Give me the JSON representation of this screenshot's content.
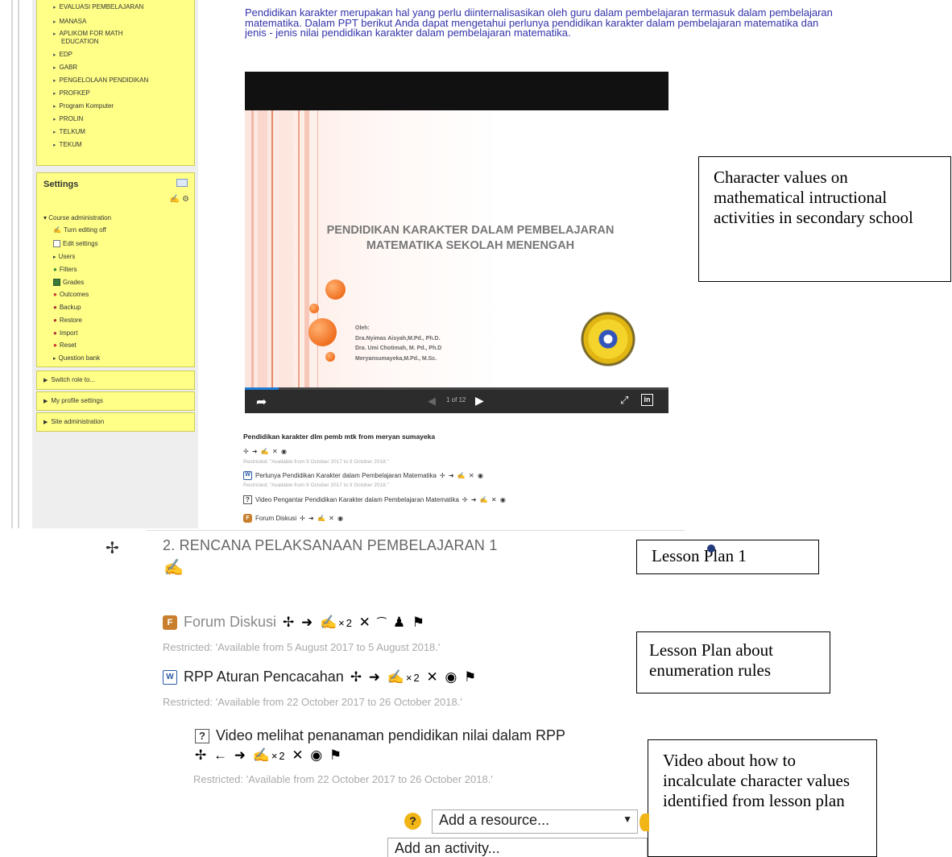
{
  "sidebar": {
    "courses": [
      "EVALUASI PEMBELAJARAN",
      "MANASA",
      "APLIKOM FOR MATH",
      "EDUCATION",
      "EDP",
      "GABR",
      "PENGELOLAAN PENDIDIKAN",
      "PROFKEP",
      "Program Komputer",
      "PROLIN",
      "TELKUM",
      "TEKUM"
    ],
    "settings_title": "Settings",
    "course_admin": "Course administration",
    "admin_items": [
      "Turn editing off",
      "Edit settings",
      "Users",
      "Filters",
      "Grades",
      "Outcomes",
      "Backup",
      "Restore",
      "Import",
      "Reset",
      "Question bank"
    ],
    "switch_role": "Switch role to...",
    "profile_settings": "My profile settings",
    "site_admin": "Site administration"
  },
  "intro_text": "Pendidikan karakter merupakan hal yang perlu diinternalisasikan oleh guru dalam pembelajaran termasuk dalam pembelajaran matematika. Dalam PPT berikut Anda dapat mengetahui perlunya pendidikan karakter dalam pembelajaran matematika dan jenis - jenis nilai pendidikan karakter dalam pembelajaran matematika.",
  "slide": {
    "title": "PENDIDIKAN KARAKTER DALAM PEMBELAJARAN MATEMATIKA SEKOLAH MENENGAH",
    "author_label": "Oleh:",
    "authors": [
      "Dra.Nyimas Aisyah,M.Pd., Ph.D.",
      "Dra. Umi Chotimah, M. Pd., Ph.D",
      "Meryansumayeka,M.Pd., M.Sc."
    ],
    "page_counter": "1 of 12",
    "progress": 0.08
  },
  "resources_top": {
    "caption": "Pendidikan karakter dlm pemb mtk from meryan sumayeka",
    "restricted_1": "Restricted: \"Available from 9 October 2017 to 9 October 2018.\"",
    "file_1": "Perlunya Pendidikan Karakter dalam Pembelajaran Matematika",
    "restricted_2": "Restricted: \"Available from 9 October 2017 to 9 October 2018.\"",
    "video_1": "Video Pengantar Pendidikan Karakter dalam Pembelajaran Matematika",
    "forum_1": "Forum Diskusi"
  },
  "callouts": {
    "character": "Character values on mathematical intructional activities in secondary school",
    "lesson_plan": "Lesson Plan 1",
    "enumeration": "Lesson Plan about enumeration rules",
    "video": "Video about how to incalculate character values identified from lesson plan"
  },
  "section": {
    "title": "2. RENCANA PELAKSANAAN PEMBELAJARAN 1",
    "forum_name": "Forum Diskusi",
    "forum_restricted": "Restricted: 'Available from 5 August 2017 to 5 August 2018.'",
    "rpp_name": "RPP Aturan Pencacahan",
    "rpp_restricted": "Restricted: 'Available from 22 October 2017 to 26 October 2018.'",
    "video_name": "Video melihat penanaman pendidikan nilai dalam RPP",
    "video_restricted": "Restricted: 'Available from 22 October 2017 to 26 October 2018.'",
    "add_resource": "Add a resource...",
    "add_activity": "Add an activity..."
  },
  "colors": {
    "sidebar_block": "#ffff88",
    "intro_text": "#3333aa",
    "slide_bubble": "#f07020"
  },
  "icons": [
    "move-icon",
    "edit-icon",
    "delete-icon",
    "hide-icon",
    "share-icon",
    "linkedin-icon",
    "help-icon"
  ]
}
